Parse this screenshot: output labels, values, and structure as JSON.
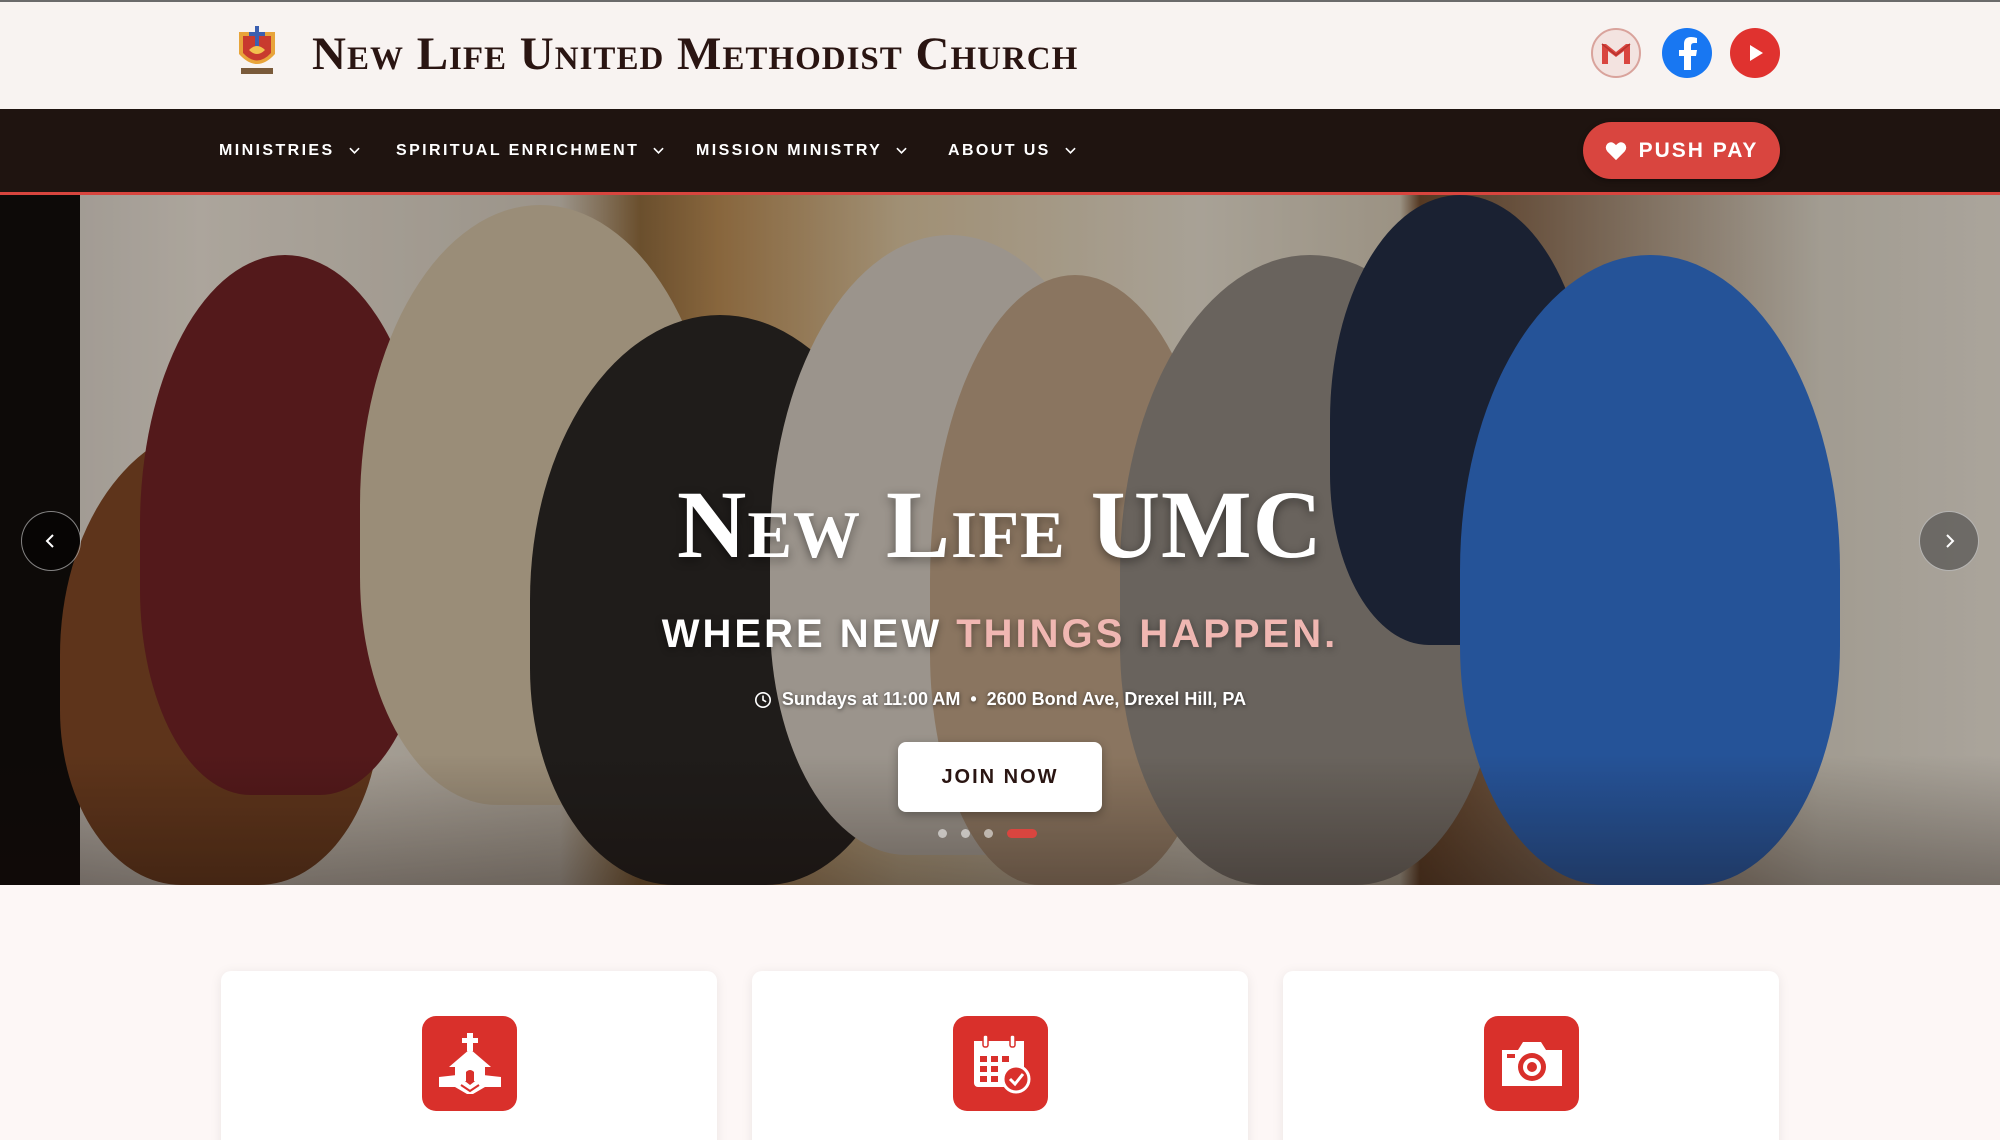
{
  "header": {
    "site_title": "New Life United Methodist Church",
    "logo_icon": "church-cross-flame-logo",
    "social": [
      {
        "name": "gmail-icon",
        "label": "Gmail"
      },
      {
        "name": "facebook-icon",
        "label": "Facebook"
      },
      {
        "name": "youtube-icon",
        "label": "YouTube"
      }
    ]
  },
  "nav": {
    "items": [
      {
        "label": "Ministries"
      },
      {
        "label": "Spiritual Enrichment"
      },
      {
        "label": "Mission Ministry"
      },
      {
        "label": "About Us"
      }
    ],
    "push_pay_label": "PUSH PAY"
  },
  "hero": {
    "title": "New Life UMC",
    "tagline_part1": "WHERE NEW ",
    "tagline_part2": "THINGS HAPPEN.",
    "service_time": "Sundays at 11:00 AM",
    "separator": "•",
    "address": "2600 Bond Ave, Drexel Hill, PA",
    "join_label": "JOIN NOW",
    "slides_total": 4,
    "active_slide": 4
  },
  "cards": [
    {
      "icon": "church-handshake-icon"
    },
    {
      "icon": "calendar-check-icon"
    },
    {
      "icon": "camera-icon"
    }
  ],
  "colors": {
    "accent": "#d9453f",
    "nav_bg": "#1f1410",
    "title_text": "#2a1512",
    "card_icon_bg": "#d9302b"
  }
}
